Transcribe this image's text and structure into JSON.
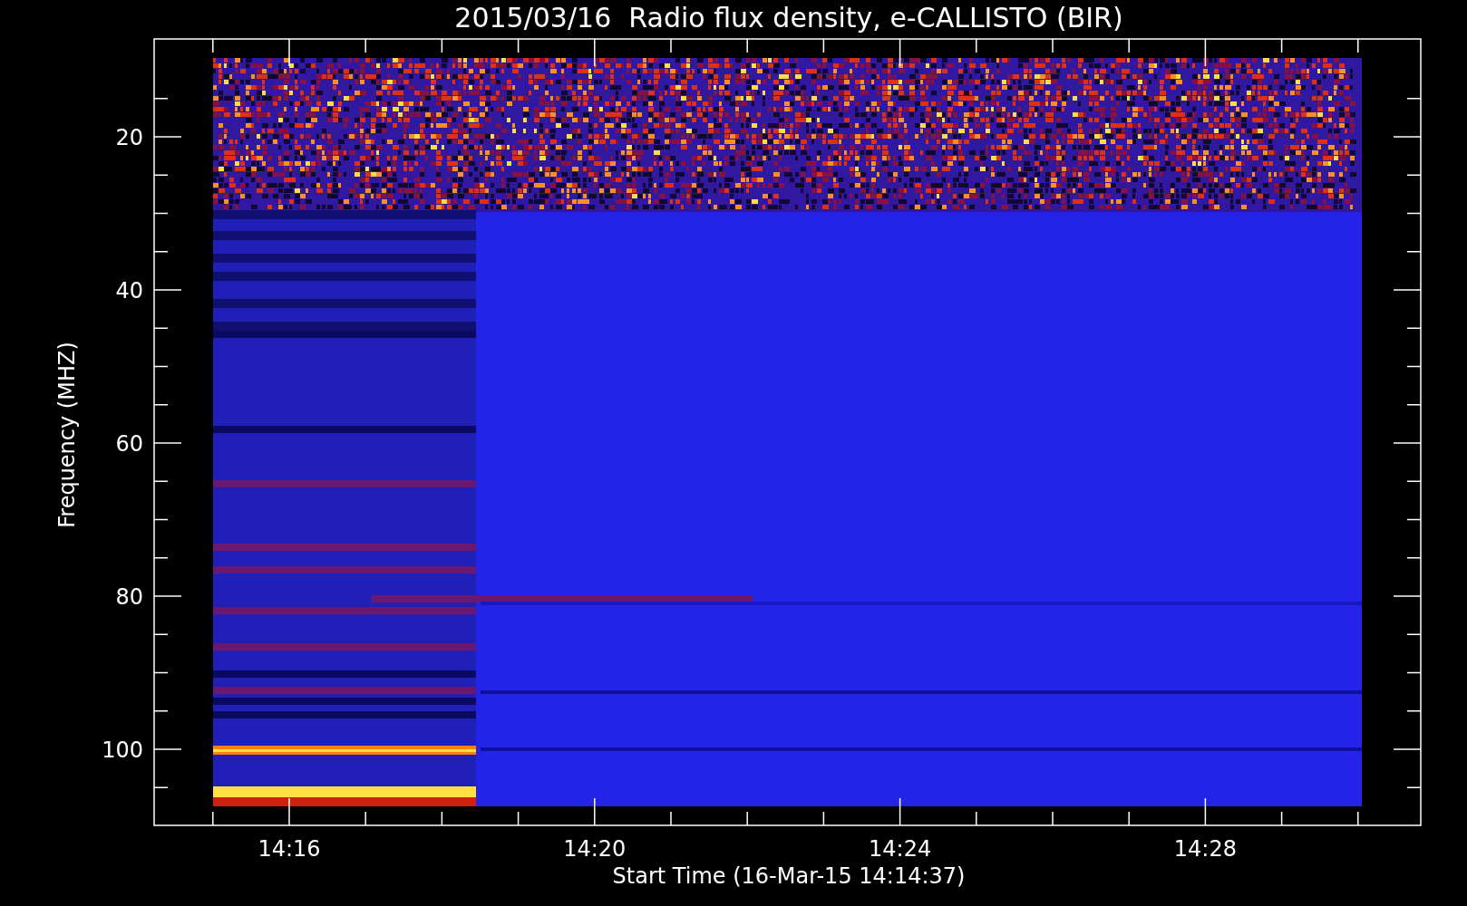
{
  "title": "2015/03/16  Radio flux density, e-CALLISTO (BIR)",
  "y_axis": {
    "label": "Frequency (MHZ)",
    "ticks": [
      "20",
      "40",
      "60",
      "80",
      "100"
    ]
  },
  "x_axis": {
    "label": "Start Time (16-Mar-15 14:14:37)",
    "ticks": [
      "14:16",
      "14:20",
      "14:24",
      "14:28"
    ]
  }
}
